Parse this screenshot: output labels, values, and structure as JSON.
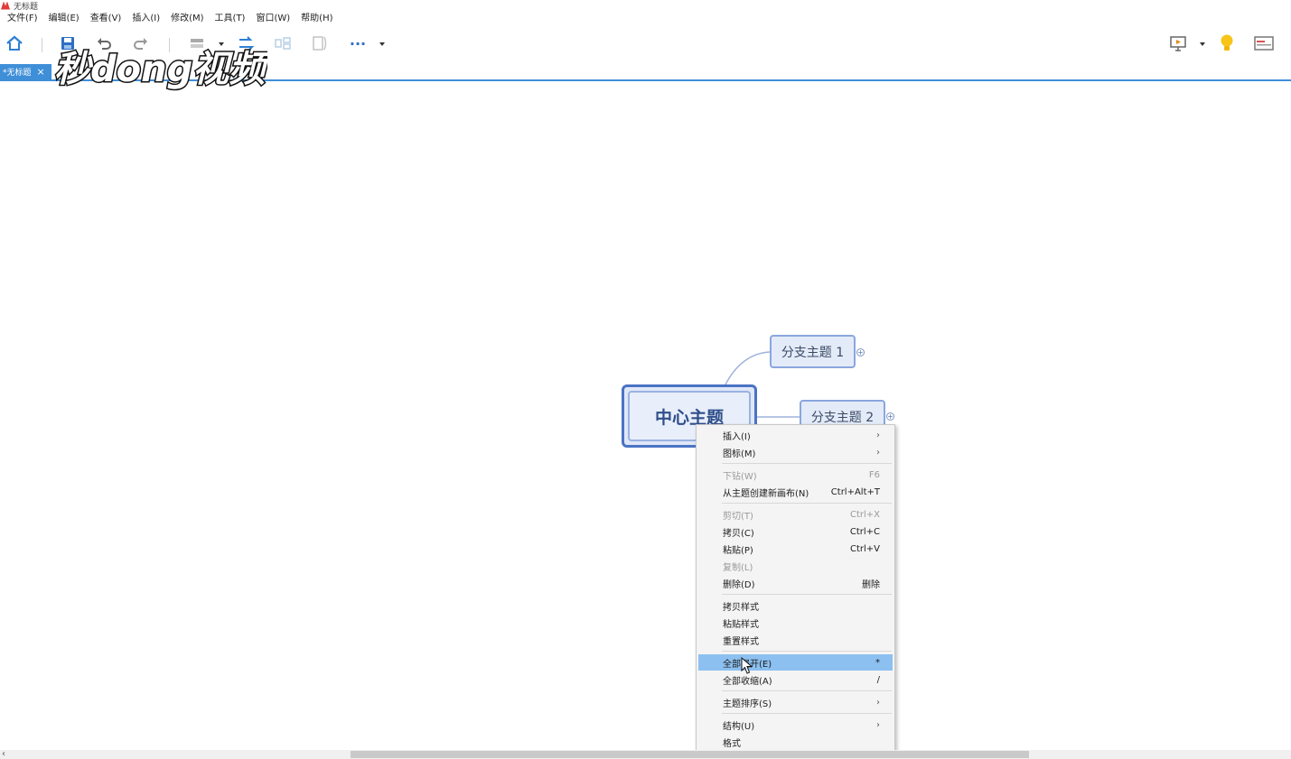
{
  "window": {
    "title": "无标题"
  },
  "menubar": {
    "items": [
      "文件(F)",
      "编辑(E)",
      "查看(V)",
      "插入(I)",
      "修改(M)",
      "工具(T)",
      "窗口(W)",
      "帮助(H)"
    ]
  },
  "toolbar": {
    "more_label": "···"
  },
  "tabs": [
    {
      "label": "*无标题",
      "close": "×"
    }
  ],
  "canvas": {
    "central_topic": "中心主题",
    "branches": [
      {
        "label": "分支主题 1",
        "expander": "+"
      },
      {
        "label": "分支主题 2",
        "expander": "+"
      }
    ]
  },
  "context_menu": {
    "items": [
      {
        "label": "插入(I)",
        "shortcut": "",
        "submenu": "›",
        "disabled": false
      },
      {
        "label": "图标(M)",
        "shortcut": "",
        "submenu": "›",
        "disabled": false
      },
      {
        "label": "下钻(W)",
        "shortcut": "F6",
        "submenu": "",
        "disabled": true
      },
      {
        "label": "从主题创建新画布(N)",
        "shortcut": "Ctrl+Alt+T",
        "submenu": "",
        "disabled": false
      },
      {
        "label": "剪切(T)",
        "shortcut": "Ctrl+X",
        "submenu": "",
        "disabled": true
      },
      {
        "label": "拷贝(C)",
        "shortcut": "Ctrl+C",
        "submenu": "",
        "disabled": false
      },
      {
        "label": "粘贴(P)",
        "shortcut": "Ctrl+V",
        "submenu": "",
        "disabled": false
      },
      {
        "label": "复制(L)",
        "shortcut": "",
        "submenu": "",
        "disabled": true
      },
      {
        "label": "删除(D)",
        "shortcut": "删除",
        "submenu": "",
        "disabled": false
      },
      {
        "label": "拷贝样式",
        "shortcut": "",
        "submenu": "",
        "disabled": false
      },
      {
        "label": "粘贴样式",
        "shortcut": "",
        "submenu": "",
        "disabled": false
      },
      {
        "label": "重置样式",
        "shortcut": "",
        "submenu": "",
        "disabled": false
      },
      {
        "label": "全部展开(E)",
        "shortcut": "*",
        "submenu": "",
        "disabled": false,
        "highlighted": true
      },
      {
        "label": "全部收缩(A)",
        "shortcut": "/",
        "submenu": "",
        "disabled": false
      },
      {
        "label": "主题排序(S)",
        "shortcut": "",
        "submenu": "›",
        "disabled": false
      },
      {
        "label": "结构(U)",
        "shortcut": "",
        "submenu": "›",
        "disabled": false
      },
      {
        "label": "格式",
        "shortcut": "",
        "submenu": "",
        "disabled": false
      }
    ]
  },
  "watermark": {
    "text": "秒dong视频"
  },
  "scrollbar": {
    "left_arrow": "‹"
  },
  "colors": {
    "accent": "#3f8fd8",
    "topic_border": "#4a73c4",
    "menu_highlight": "#8cc0f0"
  }
}
